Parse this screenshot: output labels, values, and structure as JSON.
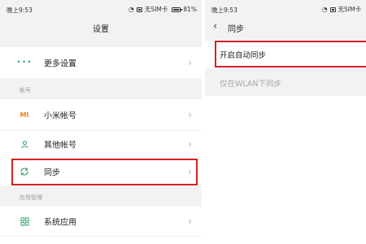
{
  "left_screen": {
    "status_bar": {
      "time": "晚上9:53",
      "signal_icon": "wifi-signal-icon",
      "sim_status": "无SIM卡",
      "battery_percent": "81%"
    },
    "title": "设置",
    "rows": {
      "more_settings": {
        "icon": "dots-icon",
        "label": "更多设置"
      },
      "mi_account": {
        "icon": "mi-logo-icon",
        "label": "小米帐号"
      },
      "other_accounts": {
        "icon": "person-icon",
        "label": "其他帐号"
      },
      "sync": {
        "icon": "sync-icon",
        "label": "同步"
      },
      "system_apps": {
        "icon": "grid-icon",
        "label": "系统应用"
      }
    },
    "sections": {
      "accounts": "帐号",
      "app_management": "应用管理"
    },
    "colors": {
      "accent": "#d81f26",
      "more_icon": "#3aa66a",
      "mi_icon": "#f07f1a",
      "person_icon": "#3aa66a",
      "sync_icon": "#3aa66a",
      "grid_icon": "#3aa66a"
    }
  },
  "right_screen": {
    "status_bar": {
      "time": "晚上9:53",
      "signal_icon": "wifi-signal-icon",
      "sim_status": "无SIM卡"
    },
    "title": "同步",
    "back_icon": "chevron-left-icon",
    "options": {
      "auto_sync": "开启自动同步",
      "wlan_only": "仅在WLAN下同步"
    }
  }
}
